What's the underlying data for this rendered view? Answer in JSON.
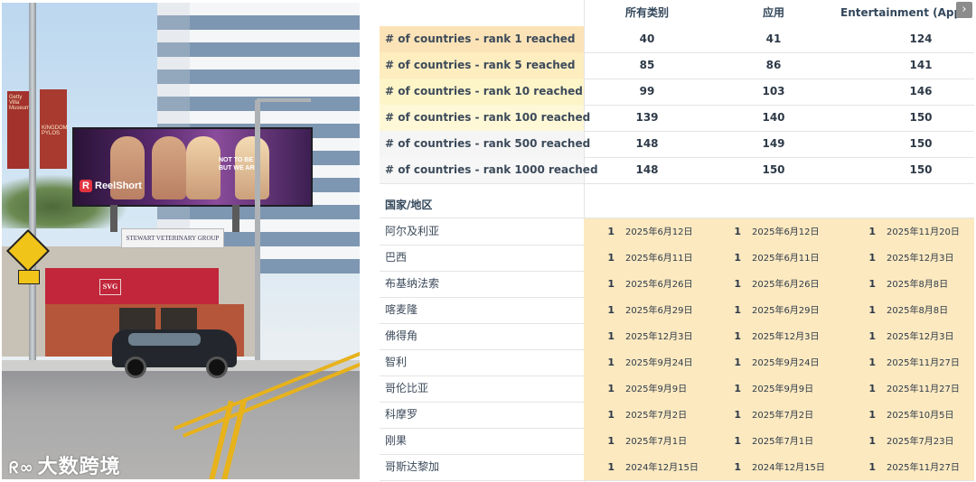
{
  "colors": {
    "rank_1": "#fce3b7",
    "rank_5": "#fdedbf",
    "rank_10": "#fdf4c8",
    "rank_100": "#fef8d6",
    "rank_500": "#f5f5f5",
    "rank_1000": "#f7f7f7",
    "country_cells": "#fce9c0",
    "header_text": "#33475b"
  },
  "photo": {
    "watermark": "大数跨境",
    "watermark_icon": "logo-icon",
    "billboard_brand": "ReelShort",
    "billboard_tagline": "NOT TO BE\nBUT WE ARE",
    "vet_sign": "STEWART VETERINARY GROUP",
    "storefront_sign": "SVG",
    "banner_left": "Getty Villa Museum",
    "banner_right": "KINGDOM PYLOS"
  },
  "table": {
    "columns": [
      "所有类别",
      "应用",
      "Entertainment (Appli"
    ],
    "next_icon": "chevron-right-icon",
    "rank_rows": [
      {
        "label": "# of countries - rank 1 reached",
        "values": [
          "40",
          "41",
          "124"
        ],
        "color": "#fce3b7"
      },
      {
        "label": "# of countries - rank 5 reached",
        "values": [
          "85",
          "86",
          "141"
        ],
        "color": "#fdedbf"
      },
      {
        "label": "# of countries - rank 10 reached",
        "values": [
          "99",
          "103",
          "146"
        ],
        "color": "#fdf4c8"
      },
      {
        "label": "# of countries - rank 100 reached",
        "values": [
          "139",
          "140",
          "150"
        ],
        "color": "#fef8d6"
      },
      {
        "label": "# of countries - rank 500 reached",
        "values": [
          "148",
          "149",
          "150"
        ],
        "color": "#f5f5f5"
      },
      {
        "label": "# of countries - rank 1000 reached",
        "values": [
          "148",
          "150",
          "150"
        ],
        "color": "#f7f7f7"
      }
    ],
    "section_title": "国家/地区",
    "country_rows": [
      {
        "country": "阿尔及利亚",
        "cells": [
          {
            "rank": "1",
            "date": "2025年6月12日"
          },
          {
            "rank": "1",
            "date": "2025年6月12日"
          },
          {
            "rank": "1",
            "date": "2025年11月20日"
          }
        ]
      },
      {
        "country": "巴西",
        "cells": [
          {
            "rank": "1",
            "date": "2025年6月11日"
          },
          {
            "rank": "1",
            "date": "2025年6月11日"
          },
          {
            "rank": "1",
            "date": "2025年12月3日"
          }
        ]
      },
      {
        "country": "布基纳法索",
        "cells": [
          {
            "rank": "1",
            "date": "2025年6月26日"
          },
          {
            "rank": "1",
            "date": "2025年6月26日"
          },
          {
            "rank": "1",
            "date": "2025年8月8日"
          }
        ]
      },
      {
        "country": "喀麦隆",
        "cells": [
          {
            "rank": "1",
            "date": "2025年6月29日"
          },
          {
            "rank": "1",
            "date": "2025年6月29日"
          },
          {
            "rank": "1",
            "date": "2025年8月8日"
          }
        ]
      },
      {
        "country": "佛得角",
        "cells": [
          {
            "rank": "1",
            "date": "2025年12月3日"
          },
          {
            "rank": "1",
            "date": "2025年12月3日"
          },
          {
            "rank": "1",
            "date": "2025年12月3日"
          }
        ]
      },
      {
        "country": "智利",
        "cells": [
          {
            "rank": "1",
            "date": "2025年9月24日"
          },
          {
            "rank": "1",
            "date": "2025年9月24日"
          },
          {
            "rank": "1",
            "date": "2025年11月27日"
          }
        ]
      },
      {
        "country": "哥伦比亚",
        "cells": [
          {
            "rank": "1",
            "date": "2025年9月9日"
          },
          {
            "rank": "1",
            "date": "2025年9月9日"
          },
          {
            "rank": "1",
            "date": "2025年11月27日"
          }
        ]
      },
      {
        "country": "科摩罗",
        "cells": [
          {
            "rank": "1",
            "date": "2025年7月2日"
          },
          {
            "rank": "1",
            "date": "2025年7月2日"
          },
          {
            "rank": "1",
            "date": "2025年10月5日"
          }
        ]
      },
      {
        "country": "刚果",
        "cells": [
          {
            "rank": "1",
            "date": "2025年7月1日"
          },
          {
            "rank": "1",
            "date": "2025年7月1日"
          },
          {
            "rank": "1",
            "date": "2025年7月23日"
          }
        ]
      },
      {
        "country": "哥斯达黎加",
        "cells": [
          {
            "rank": "1",
            "date": "2024年12月15日"
          },
          {
            "rank": "1",
            "date": "2024年12月15日"
          },
          {
            "rank": "1",
            "date": "2025年11月27日"
          }
        ]
      }
    ]
  }
}
